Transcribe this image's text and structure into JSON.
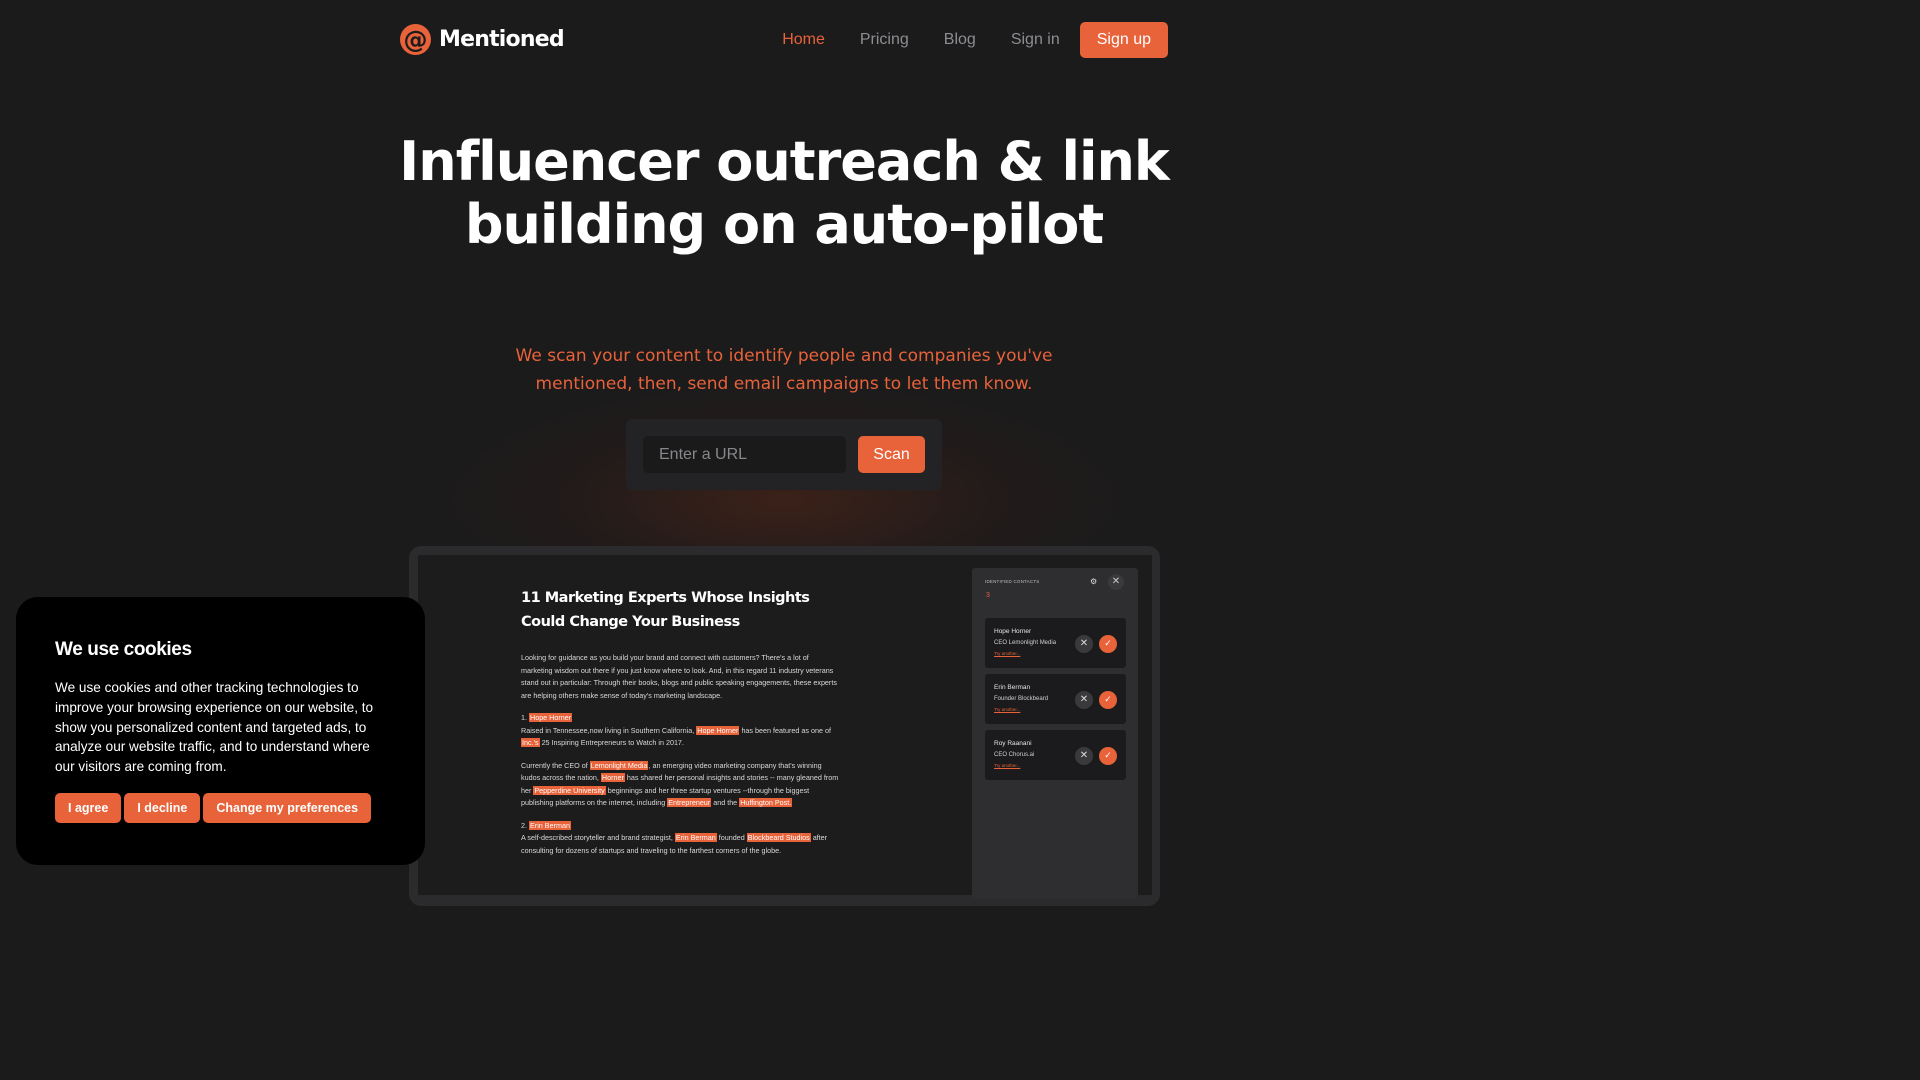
{
  "brand": {
    "name": "Mentioned",
    "logo_glyph": "@",
    "accent": "#e8623a"
  },
  "nav": {
    "items": [
      {
        "label": "Home",
        "active": true
      },
      {
        "label": "Pricing",
        "active": false
      },
      {
        "label": "Blog",
        "active": false
      },
      {
        "label": "Sign in",
        "active": false
      }
    ],
    "signup_label": "Sign up"
  },
  "hero": {
    "title": "Influencer outreach & link building on auto-pilot",
    "subtitle": "We scan your content to identify people and companies you've mentioned, then, send email campaigns to let them know.",
    "input_placeholder": "Enter a URL",
    "scan_label": "Scan"
  },
  "demo": {
    "article_title": "11 Marketing Experts Whose Insights Could Change Your Business",
    "intro": "Looking for guidance as you build your brand and connect with customers? There's a lot of marketing wisdom out there if you just know where to look. And, in this regard 11 industry veterans stand out in particular: Through their books, blogs and public speaking engagements, these experts are helping others make sense of today's marketing landscape.",
    "p1_heading_num": "1.",
    "p1_heading_name": "Hope Horner",
    "p1_a": "Raised in Tennessee,now living in Southern California,",
    "p1_hl1": "Hope Horner",
    "p1_b": "has been featured as one of",
    "p1_hl2": "Inc.'s",
    "p1_c": "25 Inspiring Entrepreneurs to Watch in 2017.",
    "p2_a": "Currently the CEO of",
    "p2_hl1": "Lemonlight Media",
    "p2_b": ", an emerging video marketing company that's winning kudos across the nation,",
    "p2_hl2": "Horner",
    "p2_c": "has shared her personal insights and stories -- many gleaned from her",
    "p2_hl3": "Pepperdine University",
    "p2_d": "beginnings and her three startup ventures --through the biggest publishing platforms on the internet, including",
    "p2_hl4": "Entrepreneur",
    "p2_e": "and the",
    "p2_hl5": "Huffington Post.",
    "p3_heading_num": "2.",
    "p3_heading_name": "Erin Berman",
    "p3_a": "A self-described storyteller and brand strategist,",
    "p3_hl1": "Erin Berman",
    "p3_b": "founded",
    "p3_hl2": "Blockbeard Studios",
    "p3_c": "after consulting for dozens of startups and traveling to the farthest corners of the globe.",
    "panel": {
      "heading": "IDENTIFIED CONTACTS",
      "count": "3",
      "contacts": [
        {
          "name": "Hope Horner",
          "role": "CEO Lemonlight Media",
          "link": "Try another..."
        },
        {
          "name": "Erin Berman",
          "role": "Founder Blockbeard",
          "link": "Try another..."
        },
        {
          "name": "Roy Raanani",
          "role": "CEO Chorus.ai",
          "link": "Try another..."
        }
      ]
    }
  },
  "cookie": {
    "title": "We use cookies",
    "text": "We use cookies and other tracking technologies to improve your browsing experience on our website, to show you personalized content and targeted ads, to analyze our website traffic, and to understand where our visitors are coming from.",
    "agree_label": "I agree",
    "decline_label": "I decline",
    "prefs_label": "Change my preferences"
  }
}
